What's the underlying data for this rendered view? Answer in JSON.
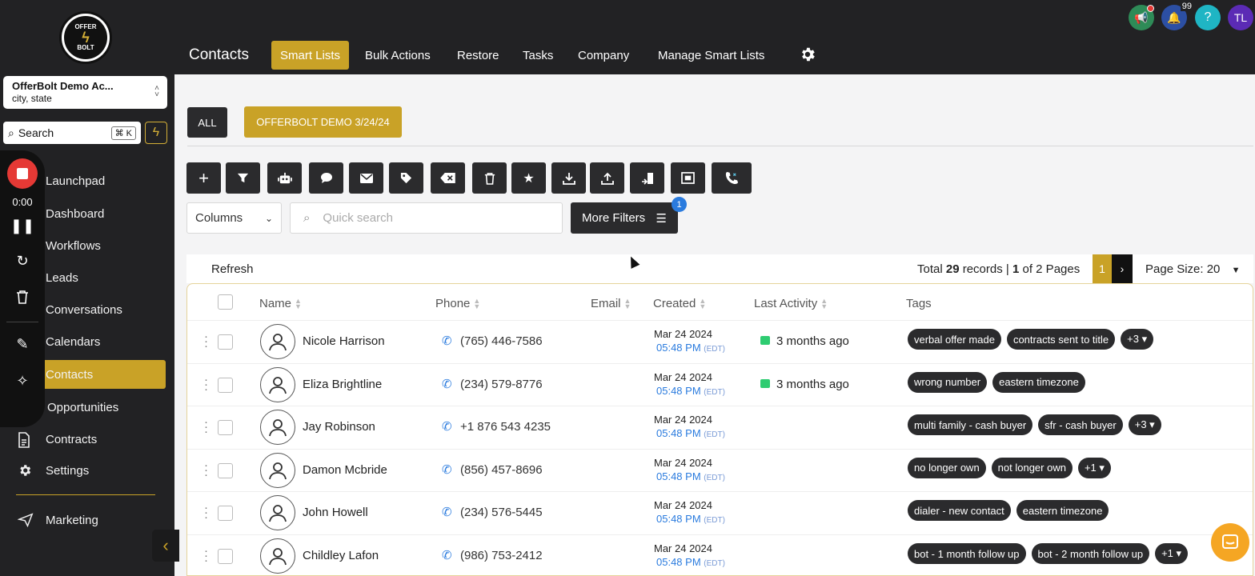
{
  "logo": {
    "text_top": "OFFER",
    "text_bottom": "BOLT"
  },
  "account": {
    "name": "OfferBolt Demo Ac...",
    "location": "city, state"
  },
  "sidebar_search": {
    "label": "Search",
    "shortcut": "⌘ K"
  },
  "recorder": {
    "time": "0:00"
  },
  "nav": [
    {
      "label": "Launchpad"
    },
    {
      "label": "Dashboard"
    },
    {
      "label": "Workflows"
    },
    {
      "label": "Leads"
    },
    {
      "label": "Conversations"
    },
    {
      "label": "Calendars"
    },
    {
      "label": "Contacts",
      "active": true
    },
    {
      "label": "Opportunities"
    },
    {
      "label": "Contracts"
    },
    {
      "label": "Settings"
    },
    {
      "label": "Marketing"
    }
  ],
  "header": {
    "title": "Contacts",
    "tabs": [
      {
        "label": "Smart Lists",
        "active": true
      },
      {
        "label": "Bulk Actions"
      },
      {
        "label": "Restore"
      },
      {
        "label": "Tasks"
      },
      {
        "label": "Company"
      },
      {
        "label": "Manage Smart Lists"
      }
    ],
    "notifications_count": "99",
    "help_label": "?",
    "avatar_initials": "TL"
  },
  "lists": {
    "all_label": "ALL",
    "smart_list_label": "OFFERBOLT DEMO 3/24/24"
  },
  "toolbar_icons": [
    "add-icon",
    "filter-icon",
    "robot-icon",
    "chat-icon",
    "email-icon",
    "tag-icon",
    "remove-tag-icon",
    "trash-icon",
    "star-icon",
    "download-icon",
    "upload-icon",
    "merge-icon",
    "import-icon",
    "dialer-icon"
  ],
  "filters": {
    "columns_label": "Columns",
    "quick_search_placeholder": "Quick search",
    "more_filters_label": "More Filters",
    "more_filters_count": "1"
  },
  "records": {
    "refresh_label": "Refresh",
    "total_prefix": "Total",
    "total_count": "29",
    "records_word": "records |",
    "page_current": "1",
    "page_suffix": "of 2 Pages",
    "pager_current": "1",
    "pager_next": "›",
    "page_size_label": "Page Size: 20"
  },
  "table": {
    "columns": [
      "Name",
      "Phone",
      "Email",
      "Created",
      "Last Activity",
      "Tags"
    ],
    "rows": [
      {
        "name": "Nicole Harrison",
        "phone": "(765) 446-7586",
        "date": "Mar 24 2024",
        "time": "05:48 PM",
        "tz": "(EDT)",
        "activity": "3 months ago",
        "tags": [
          "verbal offer made",
          "contracts sent to title",
          "+3 ▾"
        ]
      },
      {
        "name": "Eliza Brightline",
        "phone": "(234) 579-8776",
        "date": "Mar 24 2024",
        "time": "05:48 PM",
        "tz": "(EDT)",
        "activity": "3 months ago",
        "tags": [
          "wrong number",
          "eastern timezone"
        ]
      },
      {
        "name": "Jay Robinson",
        "phone": "+1 876 543 4235",
        "date": "Mar 24 2024",
        "time": "05:48 PM",
        "tz": "(EDT)",
        "activity": "",
        "tags": [
          "multi family - cash buyer",
          "sfr - cash buyer",
          "+3 ▾"
        ]
      },
      {
        "name": "Damon Mcbride",
        "phone": "(856) 457-8696",
        "date": "Mar 24 2024",
        "time": "05:48 PM",
        "tz": "(EDT)",
        "activity": "",
        "tags": [
          "no longer own",
          "not longer own",
          "+1 ▾"
        ]
      },
      {
        "name": "John Howell",
        "phone": "(234) 576-5445",
        "date": "Mar 24 2024",
        "time": "05:48 PM",
        "tz": "(EDT)",
        "activity": "",
        "tags": [
          "dialer - new contact",
          "eastern timezone"
        ]
      },
      {
        "name": "Childley Lafon",
        "phone": "(986) 753-2412",
        "date": "Mar 24 2024",
        "time": "05:48 PM",
        "tz": "(EDT)",
        "activity": "",
        "tags": [
          "bot - 1 month follow up",
          "bot - 2 month follow up",
          "+1 ▾"
        ]
      }
    ]
  },
  "colors": {
    "accent": "#c9a227",
    "dark": "#222224",
    "link": "#2a7bde"
  }
}
